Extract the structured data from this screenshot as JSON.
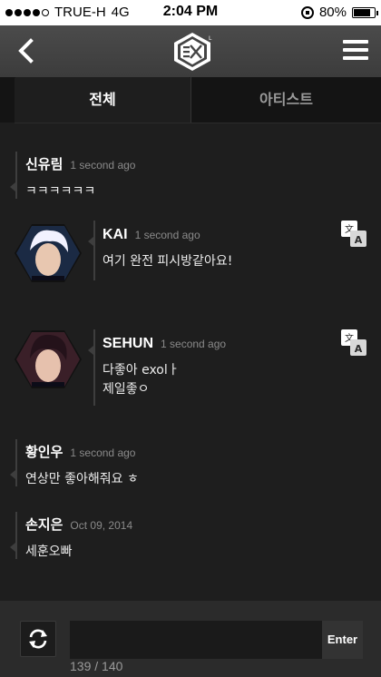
{
  "status_bar": {
    "carrier": "TRUE-H",
    "network": "4G",
    "time": "2:04 PM",
    "battery": "80%",
    "battery_level": 0.8,
    "signal_bars": 4
  },
  "nav": {
    "logo_icon": "exo-logo-icon",
    "back_icon": "chevron-left-icon",
    "menu_icon": "hamburger-menu-icon"
  },
  "tabs": [
    {
      "label": "전체",
      "active": true
    },
    {
      "label": "아티스트",
      "active": false
    }
  ],
  "comments": [
    {
      "name": "신유림",
      "time": "1 second ago",
      "text": "ㅋㅋㅋㅋㅋㅋ"
    },
    {
      "name": "황인우",
      "time": "1 second ago",
      "text": "연상만 좋아해줘요 ㅎ"
    },
    {
      "name": "손지은",
      "time": "Oct 09, 2014",
      "text": "세훈오빠"
    }
  ],
  "artist_posts": [
    {
      "name": "KAI",
      "time": "1 second ago",
      "lines": [
        "여기 완전 피시방같아요!"
      ],
      "translate_icon": "translate-icon"
    },
    {
      "name": "SEHUN",
      "time": "1 second ago",
      "lines": [
        "다좋아 exolㅏ",
        "제일좋ㅇ"
      ],
      "translate_icon": "translate-icon"
    }
  ],
  "input_bar": {
    "refresh_icon": "refresh-icon",
    "value": "",
    "enter_label": "Enter",
    "counter": "139 / 140"
  },
  "colors": {
    "background": "#1e1e1e",
    "nav": "#444444",
    "input_bar": "#2b2b2b"
  }
}
